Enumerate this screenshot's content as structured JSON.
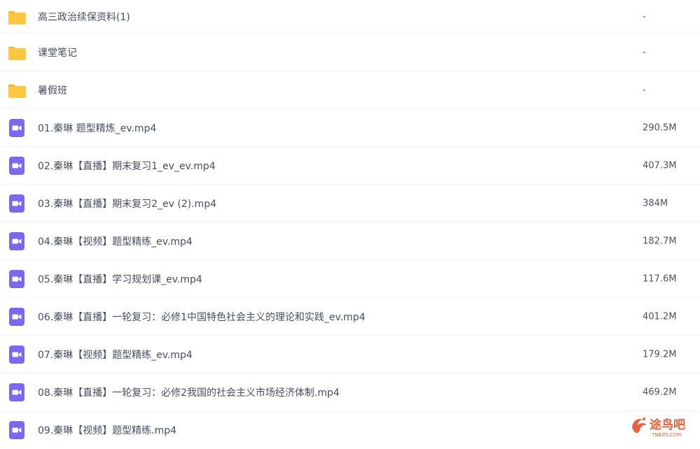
{
  "colors": {
    "folder": "#FFC63F",
    "folder_tab": "#F4B12B",
    "video": "#7B68EE",
    "watermark": "#E8613C"
  },
  "files": [
    {
      "name": "高三政治续保资料(1)",
      "size": "-",
      "type": "folder",
      "icon": "folder-icon"
    },
    {
      "name": "课堂笔记",
      "size": "-",
      "type": "folder",
      "icon": "folder-icon"
    },
    {
      "name": "暑假班",
      "size": "-",
      "type": "folder",
      "icon": "folder-icon"
    },
    {
      "name": "01.秦琳 题型精炼_ev.mp4",
      "size": "290.5M",
      "type": "video",
      "icon": "video-file-icon"
    },
    {
      "name": "02.秦琳【直播】期末复习1_ev_ev.mp4",
      "size": "407.3M",
      "type": "video",
      "icon": "video-file-icon"
    },
    {
      "name": "03.秦琳【直播】期末复习2_ev (2).mp4",
      "size": "384M",
      "type": "video",
      "icon": "video-file-icon"
    },
    {
      "name": "04.秦琳【视频】题型精练_ev.mp4",
      "size": "182.7M",
      "type": "video",
      "icon": "video-file-icon"
    },
    {
      "name": "05.秦琳【直播】学习规划课_ev.mp4",
      "size": "117.6M",
      "type": "video",
      "icon": "video-file-icon"
    },
    {
      "name": "06.秦琳【直播】一轮复习：必修1中国特色社会主义的理论和实践_ev.mp4",
      "size": "401.2M",
      "type": "video",
      "icon": "video-file-icon"
    },
    {
      "name": "07.秦琳【视频】题型精练_ev.mp4",
      "size": "179.2M",
      "type": "video",
      "icon": "video-file-icon"
    },
    {
      "name": "08.秦琳【直播】一轮复习：必修2我国的社会主义市场经济体制.mp4",
      "size": "469.2M",
      "type": "video",
      "icon": "video-file-icon"
    },
    {
      "name": "09.秦琳【视频】题型精练.mp4",
      "size": "",
      "type": "video",
      "icon": "video-file-icon"
    }
  ],
  "watermark": {
    "title": "途鸟吧",
    "subtitle": "TNBZS.COM",
    "icon": "bird-logo-icon"
  }
}
